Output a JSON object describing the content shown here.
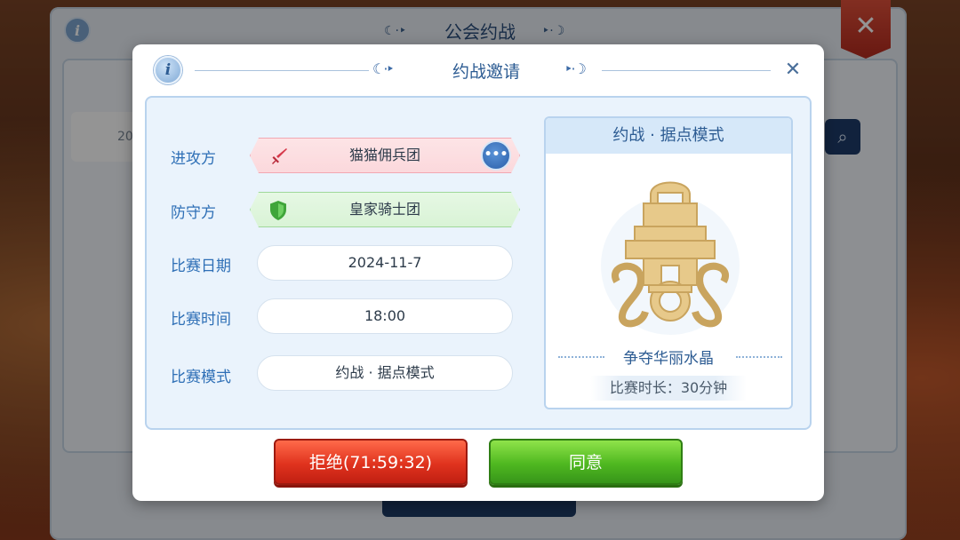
{
  "background": {
    "panel_title": "公会约战",
    "row_text": "20",
    "info_icon_glyph": "i",
    "close_glyph": "✕",
    "search_icon_glyph": "⌕"
  },
  "dialog": {
    "title": "约战邀请",
    "info_icon_glyph": "i",
    "close_glyph": "✕",
    "title_ornament_left": "☾·‣",
    "title_ornament_right": "‣·☽"
  },
  "form": {
    "attacker": {
      "label": "进攻方",
      "value": "猫猫佣兵团"
    },
    "defender": {
      "label": "防守方",
      "value": "皇家骑士团"
    },
    "date": {
      "label": "比赛日期",
      "value": "2024-11-7"
    },
    "time": {
      "label": "比赛时间",
      "value": "18:00"
    },
    "mode": {
      "label": "比赛模式",
      "value": "约战 · 据点模式"
    }
  },
  "mode_card": {
    "header": "约战 · 据点模式",
    "subtitle": "争夺华丽水晶",
    "duration": "比赛时长：30分钟"
  },
  "buttons": {
    "refuse": "拒绝(71:59:32)",
    "agree": "同意"
  },
  "icons": {
    "attacker": "sword-icon",
    "defender": "shield-icon",
    "chat": "chat-icon"
  },
  "colors": {
    "accent_blue": "#2e6fb6",
    "refuse_red": "#e0331e",
    "agree_green": "#4fb820",
    "emblem_gold": "#e7c98a"
  }
}
